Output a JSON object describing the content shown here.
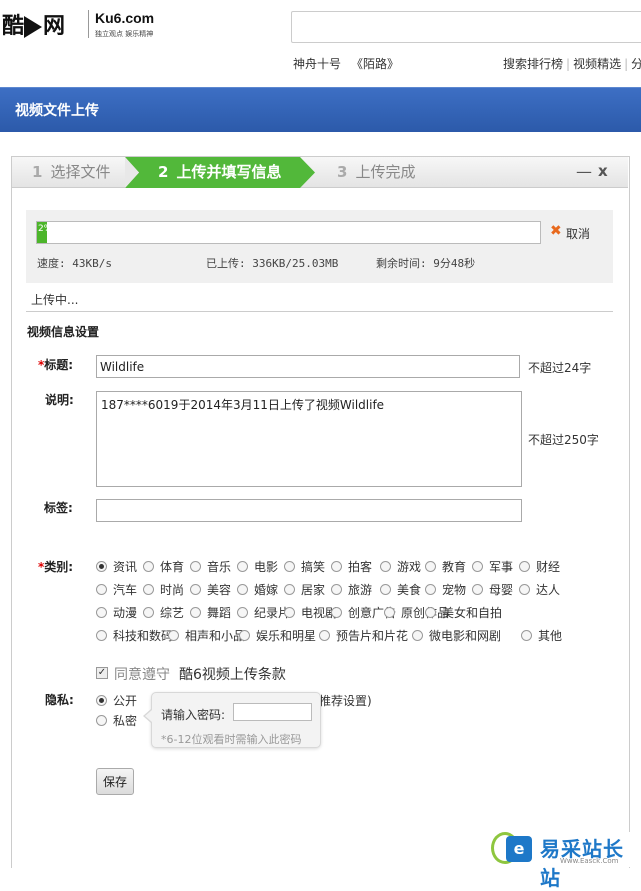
{
  "header": {
    "logo_text": "酷",
    "logo_text2": "网",
    "logo_en": "Ku6.com",
    "logo_slogan": "独立观点 娱乐精神",
    "nav_left": [
      "神舟十号",
      "《陌路》"
    ],
    "nav_right": [
      "搜索排行榜",
      "视频精选",
      "分"
    ]
  },
  "title_bar": {
    "title": "视频文件上传"
  },
  "steps": [
    {
      "num": "1",
      "label": "选择文件"
    },
    {
      "num": "2",
      "label": "上传并填写信息"
    },
    {
      "num": "3",
      "label": "上传完成"
    }
  ],
  "window_controls": {
    "minimize": "—",
    "close": "x"
  },
  "progress": {
    "percent_label": "2%",
    "fraction": 0.02,
    "cancel_label": "取消",
    "speed": "速度: 43KB/s",
    "uploaded": "已上传: 336KB/25.03MB",
    "remaining": "剩余时间: 9分48秒",
    "status": "上传中..."
  },
  "form": {
    "section_heading": "视频信息设置",
    "title_label": "标题:",
    "title_value": "Wildlife",
    "title_limit": "不超过24字",
    "desc_label": "说明:",
    "desc_value": "187****6019于2014年3月11日上传了视频Wildlife",
    "desc_limit": "不超过250字",
    "tags_label": "标签:",
    "tags_value": "",
    "category_label": "类别:",
    "categories": [
      [
        "资讯",
        "体育",
        "音乐",
        "电影",
        "搞笑",
        "拍客",
        "游戏",
        "教育",
        "军事",
        "财经"
      ],
      [
        "汽车",
        "时尚",
        "美容",
        "婚嫁",
        "居家",
        "旅游",
        "美食",
        "宠物",
        "母婴",
        "达人"
      ],
      [
        "动漫",
        "综艺",
        "舞蹈",
        "纪录片",
        "电视剧",
        "创意广告",
        "原创作品",
        "美女和自拍"
      ],
      [
        "科技和数码",
        "相声和小品",
        "娱乐和明星",
        "预告片和片花",
        "微电影和网剧",
        "其他"
      ]
    ],
    "selected_category": "资讯",
    "agree_label": "同意遵守",
    "agree_link": "酷6视频上传条款",
    "privacy_label": "隐私:",
    "privacy_public": "公开",
    "privacy_public_extra": "推荐设置)",
    "privacy_private": "私密",
    "password_prompt": "请输入密码:",
    "password_hint": "*6-12位观看时需输入此密码",
    "save_label": "保存"
  },
  "watermark": {
    "text": "易采站长站",
    "sub": "Www.Easck.Com"
  },
  "colors": {
    "title_bar": "#2c5aaa",
    "step_active": "#52b83a",
    "progress": "#4cb52a",
    "cancel": "#e8691d",
    "required": "#dd0000"
  }
}
